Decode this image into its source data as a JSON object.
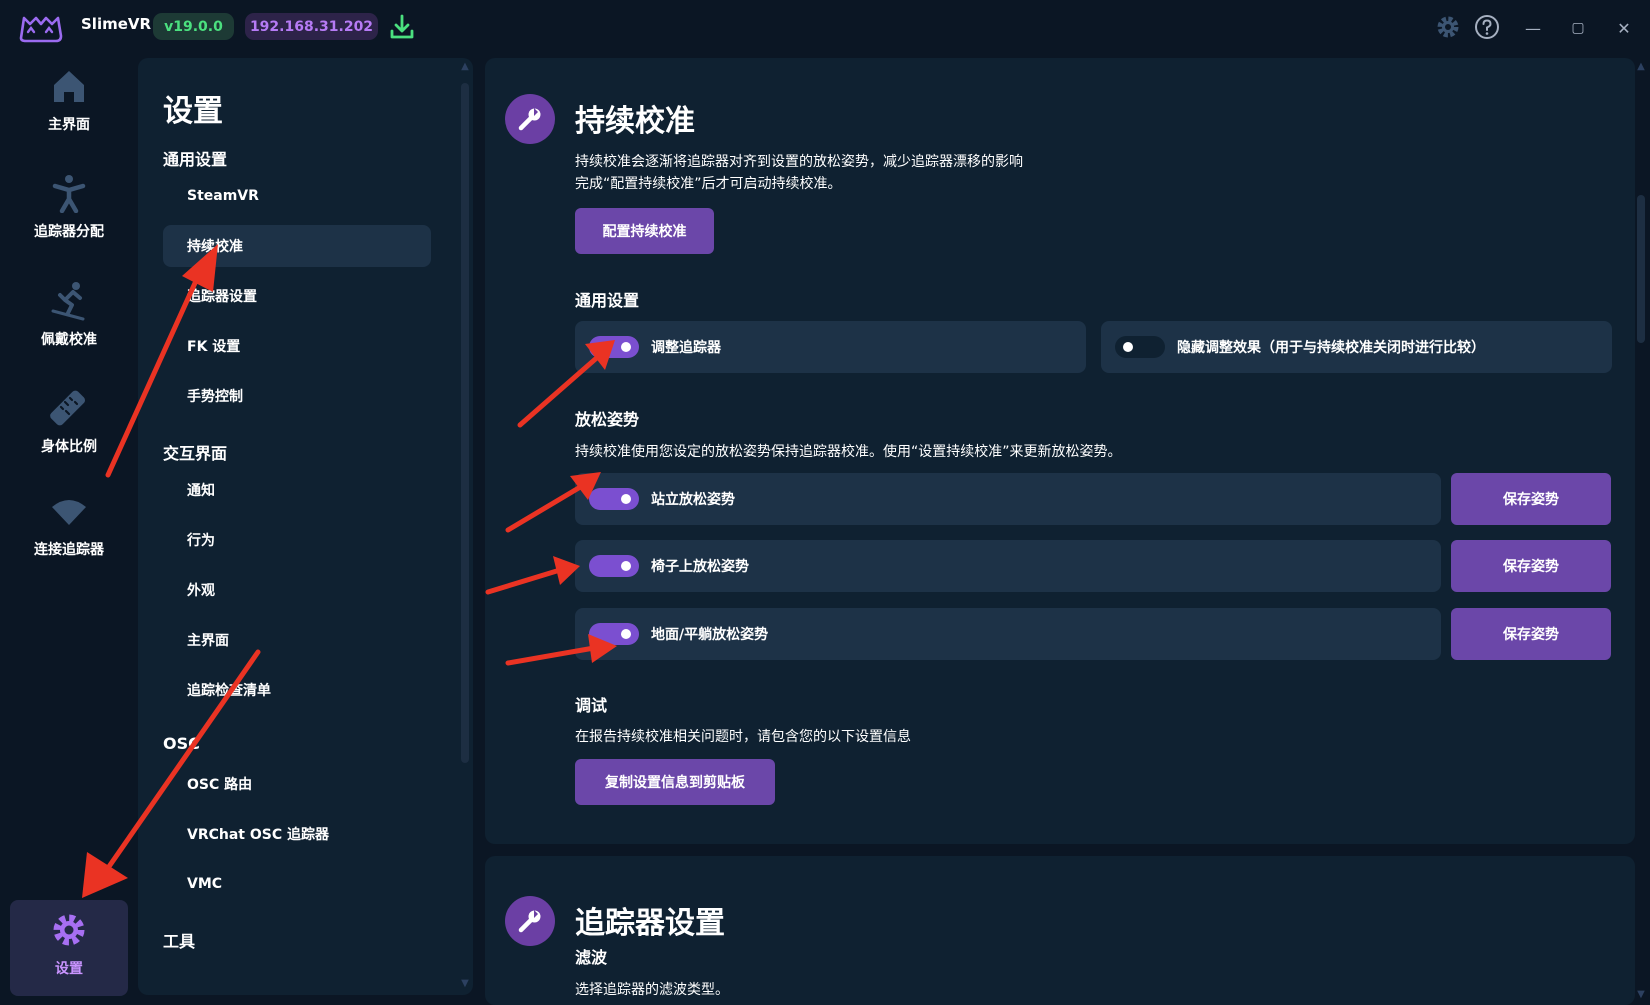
{
  "titlebar": {
    "app_name": "SlimeVR",
    "version": "v19.0.0",
    "ip": "192.168.31.202",
    "icons": [
      "download-icon",
      "gear-icon",
      "help-icon",
      "minimize-icon",
      "maximize-icon",
      "close-icon"
    ],
    "window_buttons": {
      "minimize": "—",
      "maximize": "▢",
      "close": "✕"
    }
  },
  "leftnav": {
    "items": [
      {
        "label": "主界面",
        "icon": "home-icon"
      },
      {
        "label": "追踪器分配",
        "icon": "person-icon"
      },
      {
        "label": "佩戴校准",
        "icon": "skier-icon"
      },
      {
        "label": "身体比例",
        "icon": "ruler-icon"
      },
      {
        "label": "连接追踪器",
        "icon": "wifi-icon"
      },
      {
        "label": "设置",
        "icon": "gear-icon"
      }
    ]
  },
  "menu": {
    "title": "设置",
    "sections": [
      {
        "label": "通用设置"
      },
      {
        "label": "交互界面"
      },
      {
        "label": "OSC"
      },
      {
        "label": "工具"
      }
    ],
    "items": [
      "SteamVR",
      "持续校准",
      "追踪器设置",
      "FK 设置",
      "手势控制",
      "通知",
      "行为",
      "外观",
      "主界面",
      "追踪检查清单",
      "OSC 路由",
      "VRChat OSC 追踪器",
      "VMC"
    ],
    "active_item": "持续校准"
  },
  "continuous_calibration": {
    "title": "持续校准",
    "description_line1": "持续校准会逐渐将追踪器对齐到设置的放松姿势，减少追踪器漂移的影响",
    "description_line2": "完成“配置持续校准”后才可启动持续校准。",
    "configure_button": "配置持续校准",
    "general_heading": "通用设置",
    "toggle_adjust": "调整追踪器",
    "toggle_hide": "隐藏调整效果（用于与持续校准关闭时进行比较）",
    "relaxed_heading": "放松姿势",
    "relaxed_description": "持续校准使用您设定的放松姿势保持追踪器校准。使用“设置持续校准”来更新放松姿势。",
    "pose_standing": "站立放松姿势",
    "pose_sitting": "椅子上放松姿势",
    "pose_lying": "地面/平躺放松姿势",
    "save_pose": "保存姿势",
    "debug_heading": "调试",
    "debug_description": "在报告持续校准相关问题时，请包含您的以下设置信息",
    "copy_button": "复制设置信息到剪贴板"
  },
  "tracker_settings": {
    "title": "追踪器设置",
    "filter_heading": "滤波",
    "filter_description": "选择追踪器的滤波类型。"
  },
  "toggles": {
    "adjust_trackers": true,
    "hide_adjustment": false,
    "standing": true,
    "sitting": true,
    "lying": true
  },
  "colors": {
    "background": "#0b1624",
    "panel": "#0f2131",
    "row": "#1d3247",
    "accent": "#6b47a9",
    "toggle_on": "#7b4fd0",
    "version_green": "#4be07f",
    "ip_purple": "#b67bf5",
    "annotation_red": "#ea3323"
  }
}
